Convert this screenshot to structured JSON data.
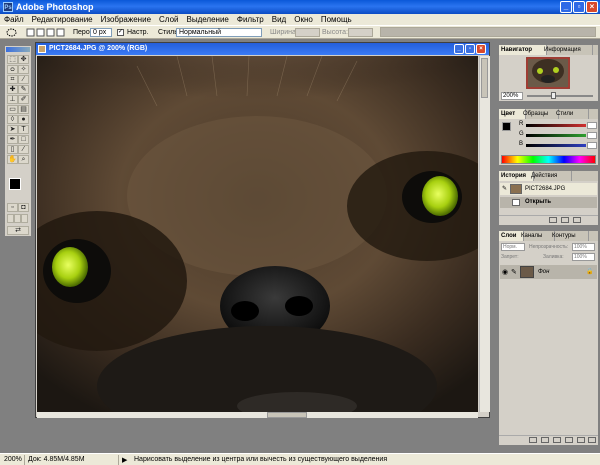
{
  "window": {
    "title": "Adobe Photoshop"
  },
  "menu": [
    "Файл",
    "Редактирование",
    "Изображение",
    "Слой",
    "Выделение",
    "Фильтр",
    "Вид",
    "Окно",
    "Помощь"
  ],
  "options": {
    "feather_label": "Перо:",
    "feather_value": "0 px",
    "antialias_label": "Настр.",
    "style_label": "Стиль:",
    "style_value": "Нормальный",
    "width_label": "Ширина:",
    "height_label": "Высота:"
  },
  "document": {
    "title": "PICT2684.JPG @ 200% (RGB)"
  },
  "navigator": {
    "tabs": [
      "Навигатор",
      "Информация"
    ],
    "zoom": "200%"
  },
  "color": {
    "tabs": [
      "Цвет",
      "Образцы",
      "Стили"
    ],
    "channels": [
      {
        "label": "R",
        "color": "#d03030"
      },
      {
        "label": "G",
        "color": "#30a030"
      },
      {
        "label": "B",
        "color": "#3040c0"
      }
    ]
  },
  "history": {
    "tabs": [
      "История",
      "Действия"
    ],
    "items": [
      {
        "label": "PICT2684.JPG"
      },
      {
        "label": "Открыть"
      }
    ]
  },
  "layers": {
    "tabs": [
      "Слои",
      "Каналы",
      "Контуры"
    ],
    "blend": "Норм.",
    "opacity_label": "Непрозрачность:",
    "opacity": "100%",
    "fill_label": "Заливка:",
    "fill": "100%",
    "lock_label": "Запрет:",
    "layer_name": "Фон"
  },
  "status": {
    "zoom": "200%",
    "doc": "Док: 4.85M/4.85M",
    "hint": "Нарисовать выделение из центра или вычесть из существующего выделения"
  }
}
